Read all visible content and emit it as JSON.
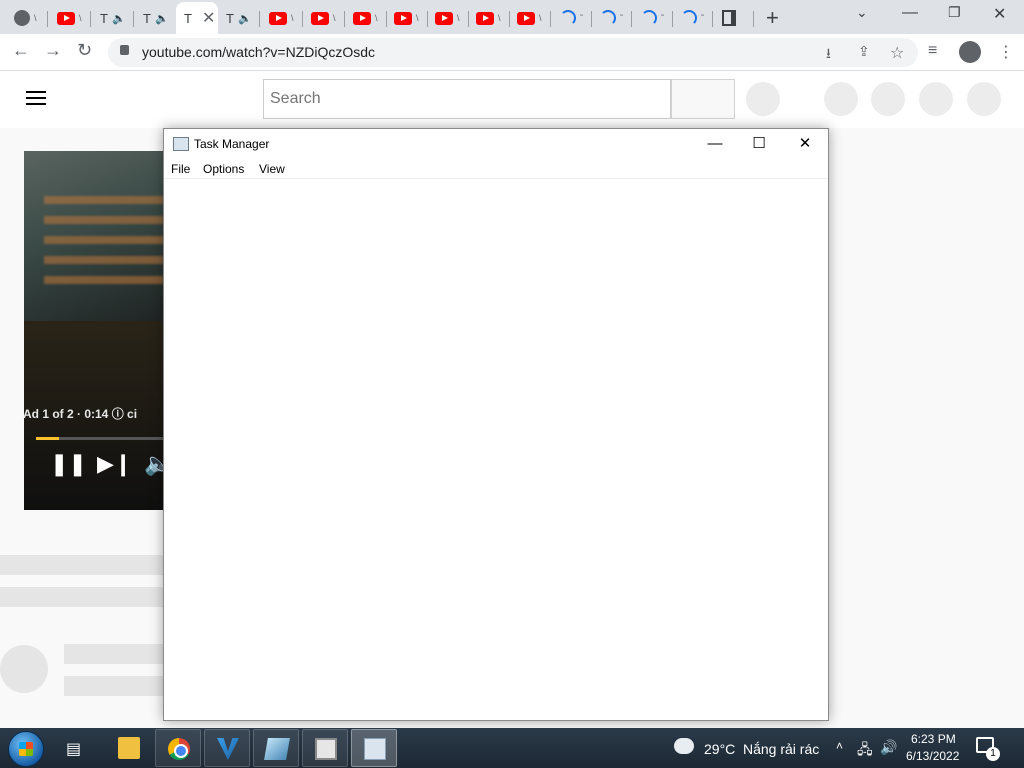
{
  "browser": {
    "tabs": [
      {
        "favicon": "globe-icon",
        "label": "\\",
        "active": false
      },
      {
        "favicon": "youtube-icon",
        "label": "\\",
        "active": false
      },
      {
        "favicon": "text",
        "label": "T",
        "audio": true,
        "active": false
      },
      {
        "favicon": "text",
        "label": "T",
        "audio": true,
        "active": false
      },
      {
        "favicon": "text",
        "label": "T",
        "active": true
      },
      {
        "favicon": "text",
        "label": "T",
        "audio": true,
        "active": false
      },
      {
        "favicon": "youtube-icon",
        "label": "\\",
        "active": false
      },
      {
        "favicon": "youtube-icon",
        "label": "\\",
        "active": false
      },
      {
        "favicon": "youtube-icon",
        "label": "\\",
        "active": false
      },
      {
        "favicon": "youtube-icon",
        "label": "\\",
        "active": false
      },
      {
        "favicon": "youtube-icon",
        "label": "\\",
        "active": false
      },
      {
        "favicon": "youtube-icon",
        "label": "\\",
        "active": false
      },
      {
        "favicon": "youtube-icon",
        "label": "\\",
        "active": false
      },
      {
        "favicon": "loading-spinner-icon",
        "label": "˜",
        "active": false
      },
      {
        "favicon": "loading-spinner-icon",
        "label": "˜",
        "active": false
      },
      {
        "favicon": "loading-spinner-icon",
        "label": "˜",
        "active": false
      },
      {
        "favicon": "loading-spinner-icon",
        "label": "˜",
        "active": false
      },
      {
        "favicon": "book-icon",
        "label": "",
        "active": false
      }
    ],
    "new_tab_label": "+",
    "url": "youtube.com/watch?v=NZDiQczOsdc",
    "nav_back": "←",
    "nav_forward": "→",
    "nav_reload": "↻",
    "win_min": "—",
    "win_restore": "❐",
    "win_close": "✕",
    "tab_dropdown": "⌄"
  },
  "youtube": {
    "search_placeholder": "Search",
    "ad_text": "Ad 1 of 2 · 0:14  ⓘ   ci",
    "progress_fraction": 0.18
  },
  "task_manager": {
    "title": "Task Manager",
    "menus": [
      "File",
      "Options",
      "View"
    ],
    "minimize": "—",
    "maximize": "☐",
    "close": "✕"
  },
  "taskbar": {
    "weather_temp": "29°C",
    "weather_desc": "Nắng rải rác",
    "time": "6:23 PM",
    "date": "6/13/2022",
    "notification_count": "1",
    "tray_caret": "˄"
  }
}
